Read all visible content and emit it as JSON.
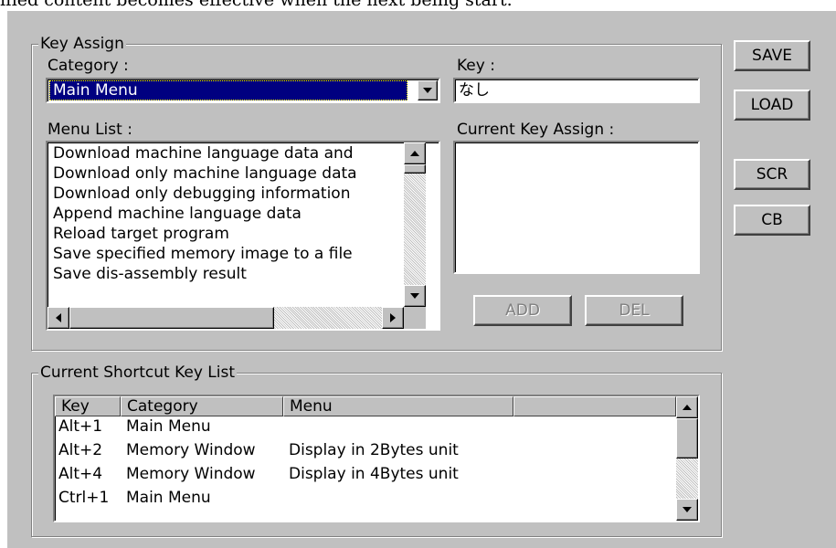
{
  "top_text": "ified content becomes effective when the next being start.",
  "key_assign": {
    "legend": "Key Assign",
    "category_label": "Category :",
    "category_value": "Main Menu",
    "key_label": "Key :",
    "key_value": "なし",
    "menu_list_label": "Menu List :",
    "menu_items": [
      "Download machine language data and",
      "Download only machine language data",
      "Download only debugging information",
      "Append machine language data",
      "Reload target program",
      "Save specified memory image to a file",
      "Save dis-assembly result"
    ],
    "current_assign_label": "Current Key Assign :",
    "add_button": "ADD",
    "del_button": "DEL"
  },
  "side_buttons": {
    "save": "SAVE",
    "load": "LOAD",
    "scr": "SCR",
    "cb": "CB"
  },
  "shortcut_list": {
    "legend": "Current Shortcut Key List",
    "columns": [
      "Key",
      "Category",
      "Menu",
      ""
    ],
    "rows": [
      {
        "key": "Alt+1",
        "category": "Main Menu",
        "menu": ""
      },
      {
        "key": "Alt+2",
        "category": "Memory Window",
        "menu": "Display in 2Bytes unit"
      },
      {
        "key": "Alt+4",
        "category": "Memory Window",
        "menu": "Display in 4Bytes unit"
      },
      {
        "key": "Ctrl+1",
        "category": "Main Menu",
        "menu": ""
      }
    ]
  },
  "colors": {
    "face": "#c0c0c0",
    "selection": "#000080",
    "selection_text": "#ffffff",
    "disabled_text": "#808080"
  },
  "icons": {
    "dropdown": "chevron-down-icon",
    "scroll_up": "arrow-up-icon",
    "scroll_down": "arrow-down-icon",
    "scroll_left": "arrow-left-icon",
    "scroll_right": "arrow-right-icon"
  }
}
